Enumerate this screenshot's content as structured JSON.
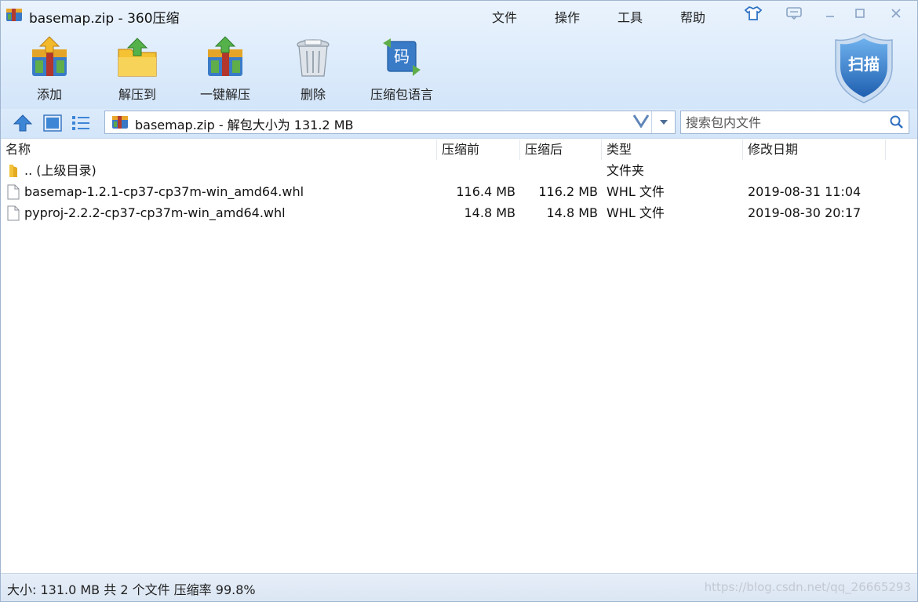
{
  "window": {
    "title": "basemap.zip - 360压缩"
  },
  "menu": {
    "file": "文件",
    "operate": "操作",
    "tools": "工具",
    "help": "帮助"
  },
  "toolbar": {
    "add": "添加",
    "extract_to": "解压到",
    "one_click_extract": "一键解压",
    "delete": "删除",
    "archive_language": "压缩包语言",
    "language_icon_char": "码"
  },
  "scan": {
    "label": "扫描"
  },
  "address": {
    "path": "basemap.zip - 解包大小为 131.2 MB",
    "search_placeholder": "搜索包内文件"
  },
  "columns": {
    "name": "名称",
    "compressed_before": "压缩前",
    "compressed_after": "压缩后",
    "type": "类型",
    "modified": "修改日期"
  },
  "files": [
    {
      "name": ".. (上级目录)",
      "size_before": "",
      "size_after": "",
      "type": "文件夹",
      "modified": ""
    },
    {
      "name": "basemap-1.2.1-cp37-cp37m-win_amd64.whl",
      "size_before": "116.4 MB",
      "size_after": "116.2 MB",
      "type": "WHL 文件",
      "modified": "2019-08-31 11:04"
    },
    {
      "name": "pyproj-2.2.2-cp37-cp37m-win_amd64.whl",
      "size_before": "14.8 MB",
      "size_after": "14.8 MB",
      "type": "WHL 文件",
      "modified": "2019-08-30 20:17"
    }
  ],
  "status": {
    "text": "大小: 131.0 MB 共 2 个文件 压缩率 99.8%",
    "watermark": "https://blog.csdn.net/qq_26665293"
  },
  "colors": {
    "accent": "#3b7fd0",
    "toolbar_bg": "#dcebfb",
    "scan_badge": "#2f78c9"
  }
}
